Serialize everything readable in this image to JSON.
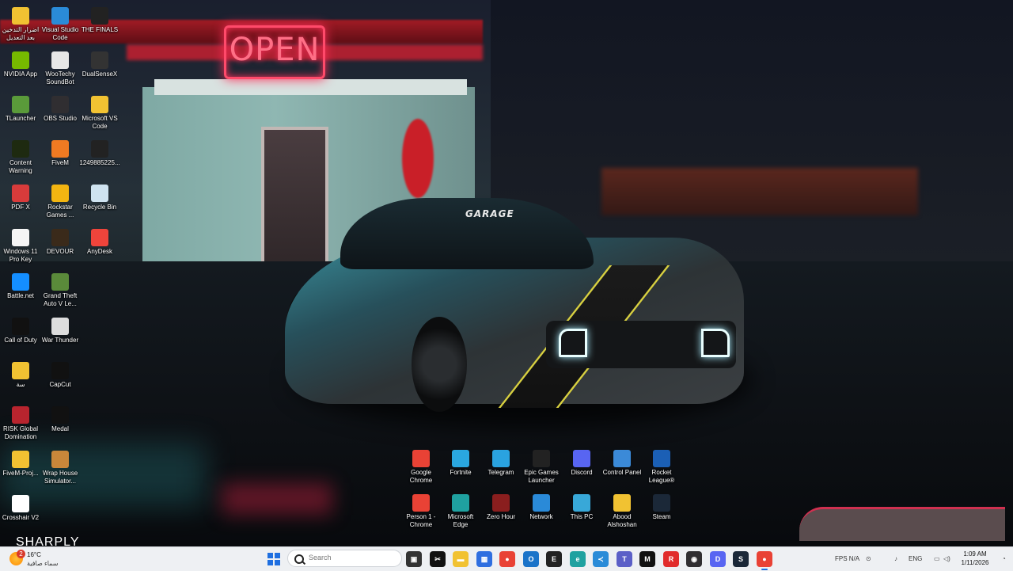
{
  "desktop": {
    "icons": [
      {
        "label": "اضرار التدخين بعد التعديل",
        "icon": "folder-icon",
        "color": "#f1c232"
      },
      {
        "label": "Visual Studio Code",
        "icon": "vscode-icon",
        "color": "#2a8bd8"
      },
      {
        "label": "THE FINALS",
        "icon": "the-finals-icon",
        "color": "#222222"
      },
      {
        "label": "NVIDIA App",
        "icon": "nvidia-icon",
        "color": "#76b900"
      },
      {
        "label": "WooTechy SoundBot",
        "icon": "soundbot-icon",
        "color": "#e7e7e7"
      },
      {
        "label": "DualSenseX",
        "icon": "dualsensex-icon",
        "color": "#333333"
      },
      {
        "label": "TLauncher",
        "icon": "tlauncher-icon",
        "color": "#5a9a3a"
      },
      {
        "label": "OBS Studio",
        "icon": "obs-icon",
        "color": "#302e31"
      },
      {
        "label": "Microsoft VS Code",
        "icon": "folder-icon",
        "color": "#f1c232"
      },
      {
        "label": "Content Warning",
        "icon": "content-warning-icon",
        "color": "#1e2a10"
      },
      {
        "label": "FiveM",
        "icon": "fivem-icon",
        "color": "#f07a22"
      },
      {
        "label": "1249885225...",
        "icon": "file-icon",
        "color": "#222222"
      },
      {
        "label": "PDF X",
        "icon": "pdfx-icon",
        "color": "#d83b3b"
      },
      {
        "label": "Rockstar Games ...",
        "icon": "rockstar-icon",
        "color": "#f3b511"
      },
      {
        "label": "Recycle Bin",
        "icon": "recycle-bin-icon",
        "color": "#cfe3f0"
      },
      {
        "label": "Windows 11 Pro Key",
        "icon": "text-file-icon",
        "color": "#f5f5f5"
      },
      {
        "label": "DEVOUR",
        "icon": "devour-icon",
        "color": "#3a2a1a"
      },
      {
        "label": "AnyDesk",
        "icon": "anydesk-icon",
        "color": "#ef443b"
      },
      {
        "label": "Battle.net",
        "icon": "battlenet-icon",
        "color": "#148eff"
      },
      {
        "label": "Grand Theft Auto V Le...",
        "icon": "gta-icon",
        "color": "#5a8a3a"
      },
      {
        "label": "Call of Duty",
        "icon": "call-of-duty-icon",
        "color": "#111111"
      },
      {
        "label": "War Thunder",
        "icon": "war-thunder-icon",
        "color": "#dddddd"
      },
      {
        "label": "سة",
        "icon": "folder-icon",
        "color": "#f1c232"
      },
      {
        "label": "CapCut",
        "icon": "capcut-icon",
        "color": "#111111"
      },
      {
        "label": "RISK Global Domination",
        "icon": "risk-icon",
        "color": "#b8242e"
      },
      {
        "label": "Medal",
        "icon": "medal-icon",
        "color": "#111111"
      },
      {
        "label": "FiveM-Proj...",
        "icon": "folder-icon",
        "color": "#f1c232"
      },
      {
        "label": "Wrap House Simulator...",
        "icon": "wrap-house-icon",
        "color": "#c9873a"
      },
      {
        "label": "Crosshair V2",
        "icon": "crosshair-icon",
        "color": "#ffffff"
      },
      {
        "label": "Google Chrome",
        "icon": "chrome-icon",
        "color": "#e94235"
      },
      {
        "label": "Fortnite",
        "icon": "fortnite-icon",
        "color": "#2aa7e0"
      },
      {
        "label": "Telegram",
        "icon": "telegram-icon",
        "color": "#2aa3e0"
      },
      {
        "label": "Epic Games Launcher",
        "icon": "epic-games-icon",
        "color": "#222222"
      },
      {
        "label": "Discord",
        "icon": "discord-icon",
        "color": "#5865f2"
      },
      {
        "label": "Control Panel",
        "icon": "control-panel-icon",
        "color": "#3b8ad8"
      },
      {
        "label": "Rocket League®",
        "icon": "rocket-league-icon",
        "color": "#1b5fb5"
      },
      {
        "label": "Person 1 - Chrome",
        "icon": "chrome-icon",
        "color": "#e94235"
      },
      {
        "label": "Microsoft Edge",
        "icon": "edge-icon",
        "color": "#1fa1a0"
      },
      {
        "label": "Zero Hour",
        "icon": "zero-hour-icon",
        "color": "#8a1e1e"
      },
      {
        "label": "Network",
        "icon": "network-icon",
        "color": "#2a8ad8"
      },
      {
        "label": "This PC",
        "icon": "this-pc-icon",
        "color": "#38a8d8"
      },
      {
        "label": "Abood Alshoshan",
        "icon": "folder-icon",
        "color": "#f1c232"
      },
      {
        "label": "Steam",
        "icon": "steam-icon",
        "color": "#1b2838"
      }
    ]
  },
  "wallpaper": {
    "sign_text": "OPEN",
    "car_badge": "GARAGE",
    "corner_text": "SHARPLY"
  },
  "taskbar": {
    "weather": {
      "badge": "2",
      "temp": "16°C",
      "condition": "سماء صافية"
    },
    "search": {
      "placeholder": "Search"
    },
    "apps": [
      {
        "name": "task-view-icon",
        "color": "#333333",
        "glyph": "▣"
      },
      {
        "name": "capcut-taskbar-icon",
        "color": "#111111",
        "glyph": "✂"
      },
      {
        "name": "file-explorer-icon",
        "color": "#f1c232",
        "glyph": "▬"
      },
      {
        "name": "store-icon",
        "color": "#2f6fe0",
        "glyph": "▦"
      },
      {
        "name": "chrome-taskbar-icon",
        "color": "#e94235",
        "glyph": "●"
      },
      {
        "name": "outlook-icon",
        "color": "#1a73c9",
        "glyph": "O"
      },
      {
        "name": "epic-taskbar-icon",
        "color": "#222222",
        "glyph": "E"
      },
      {
        "name": "edge-taskbar-icon",
        "color": "#1fa1a0",
        "glyph": "e"
      },
      {
        "name": "vscode-taskbar-icon",
        "color": "#2a8bd8",
        "glyph": "≺"
      },
      {
        "name": "teams-icon",
        "color": "#5b5fc7",
        "glyph": "T"
      },
      {
        "name": "capcut2-taskbar-icon",
        "color": "#111111",
        "glyph": "M"
      },
      {
        "name": "rockstar-taskbar-icon",
        "color": "#e12b2b",
        "glyph": "R"
      },
      {
        "name": "obs-taskbar-icon",
        "color": "#302e31",
        "glyph": "◉"
      },
      {
        "name": "discord-taskbar-icon",
        "color": "#5865f2",
        "glyph": "D"
      },
      {
        "name": "steam-taskbar-icon",
        "color": "#1b2838",
        "glyph": "S"
      },
      {
        "name": "chrome-active-taskbar-icon",
        "color": "#e94235",
        "glyph": "●"
      }
    ],
    "tray": {
      "fps": "FPS N/A",
      "lang": "ENG",
      "time": "1:09 AM",
      "date": "1/11/2026"
    }
  }
}
